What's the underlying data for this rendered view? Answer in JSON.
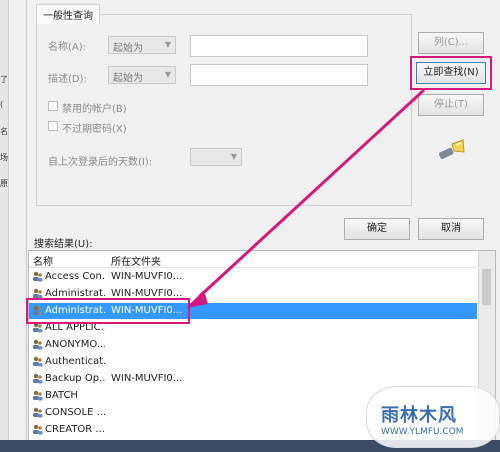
{
  "group_tab": "一般性查询",
  "fields": {
    "name_label": "名称(A):",
    "name_mode": "起始为",
    "desc_label": "描述(D):",
    "desc_mode": "起始为",
    "disabled_accounts": "禁用的帐户(B)",
    "non_expiring_password": "不过期密码(X)",
    "days_since_logon_label": "自上次登录后的天数(I):"
  },
  "buttons": {
    "columns": "列(C)...",
    "find_now": "立即查找(N)",
    "stop": "停止(T)",
    "ok": "确定",
    "cancel": "取消"
  },
  "results": {
    "label": "搜索结果(U):",
    "col_name": "名称",
    "col_folder": "所在文件夹",
    "rows": [
      {
        "name": "Access Con...",
        "folder": "WIN-MUVFI0..."
      },
      {
        "name": "Administrat...",
        "folder": "WIN-MUVFI0..."
      },
      {
        "name": "Administrat...",
        "folder": "WIN-MUVFI0..."
      },
      {
        "name": "ALL APPLIC...",
        "folder": ""
      },
      {
        "name": "ANONYMO...",
        "folder": ""
      },
      {
        "name": "Authenticat...",
        "folder": ""
      },
      {
        "name": "Backup Op...",
        "folder": "WIN-MUVFI0..."
      },
      {
        "name": "BATCH",
        "folder": ""
      },
      {
        "name": "CONSOLE ...",
        "folder": ""
      },
      {
        "name": "CREATOR ...",
        "folder": ""
      }
    ]
  },
  "left_strip": [
    "了",
    "(",
    "名",
    "场",
    "原"
  ],
  "watermark": {
    "text": "雨林木风",
    "url": "WWW.YLMFU.COM"
  },
  "colors": {
    "highlight": "#d4197c",
    "selection": "#3399ff"
  }
}
